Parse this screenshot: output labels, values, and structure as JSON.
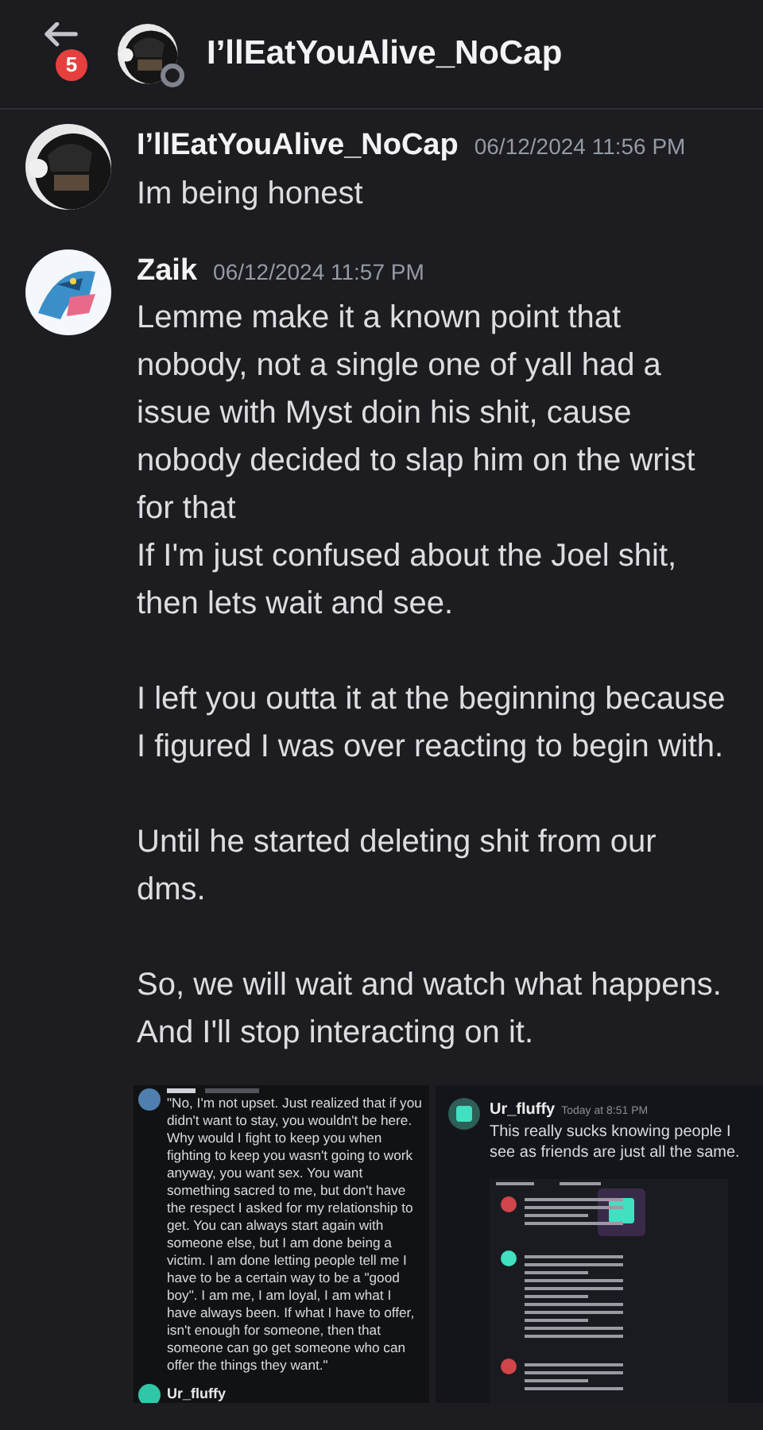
{
  "header": {
    "badge": "5",
    "title": "I’llEatYouAlive_NoCap",
    "online": false
  },
  "messages": [
    {
      "author": "I’llEatYouAlive_NoCap",
      "time": "06/12/2024 11:56 PM",
      "avatar": {
        "kind": "picture"
      },
      "blocks": [
        [
          "Im being honest"
        ]
      ]
    },
    {
      "author": "Zaik",
      "time": "06/12/2024 11:57 PM",
      "avatar": {
        "kind": "picture"
      },
      "blocks": [
        [
          "Lemme make it a known point that nobody, not a single one of yall had a issue with Myst doin his shit, cause nobody decided to slap him on the wrist for that",
          "If I'm just confused about the Joel shit, then lets wait and see."
        ],
        [
          "I left you outta it at the beginning because I figured I was over reacting to begin with."
        ],
        [
          "Until he started deleting shit from our dms."
        ],
        [
          "So, we will wait and watch what happens. And I'll stop interacting on it."
        ]
      ],
      "attachments": [
        {
          "quote": "\"No, I'm not upset. Just realized that if you didn't want to stay, you wouldn't be here. Why would I fight to keep you when fighting to keep you wasn't going to work anyway, you want sex. You want something sacred to me, but don't have the respect I asked for my relationship to get. You can always start again with someone else, but I am done being a victim. I am done letting people tell me I have to be a certain way to be a \"good boy\". I am me, I am loyal, I am what I have always been. If what I have to offer, isn't enough for someone, then that someone can go get someone who can offer the things they want.\"",
          "next_author": "Ur_fluffy"
        },
        {
          "author": "Ur_fluffy",
          "time": "Today at 8:51 PM",
          "text": "This really sucks knowing people I see as friends are just all the same."
        }
      ]
    }
  ]
}
